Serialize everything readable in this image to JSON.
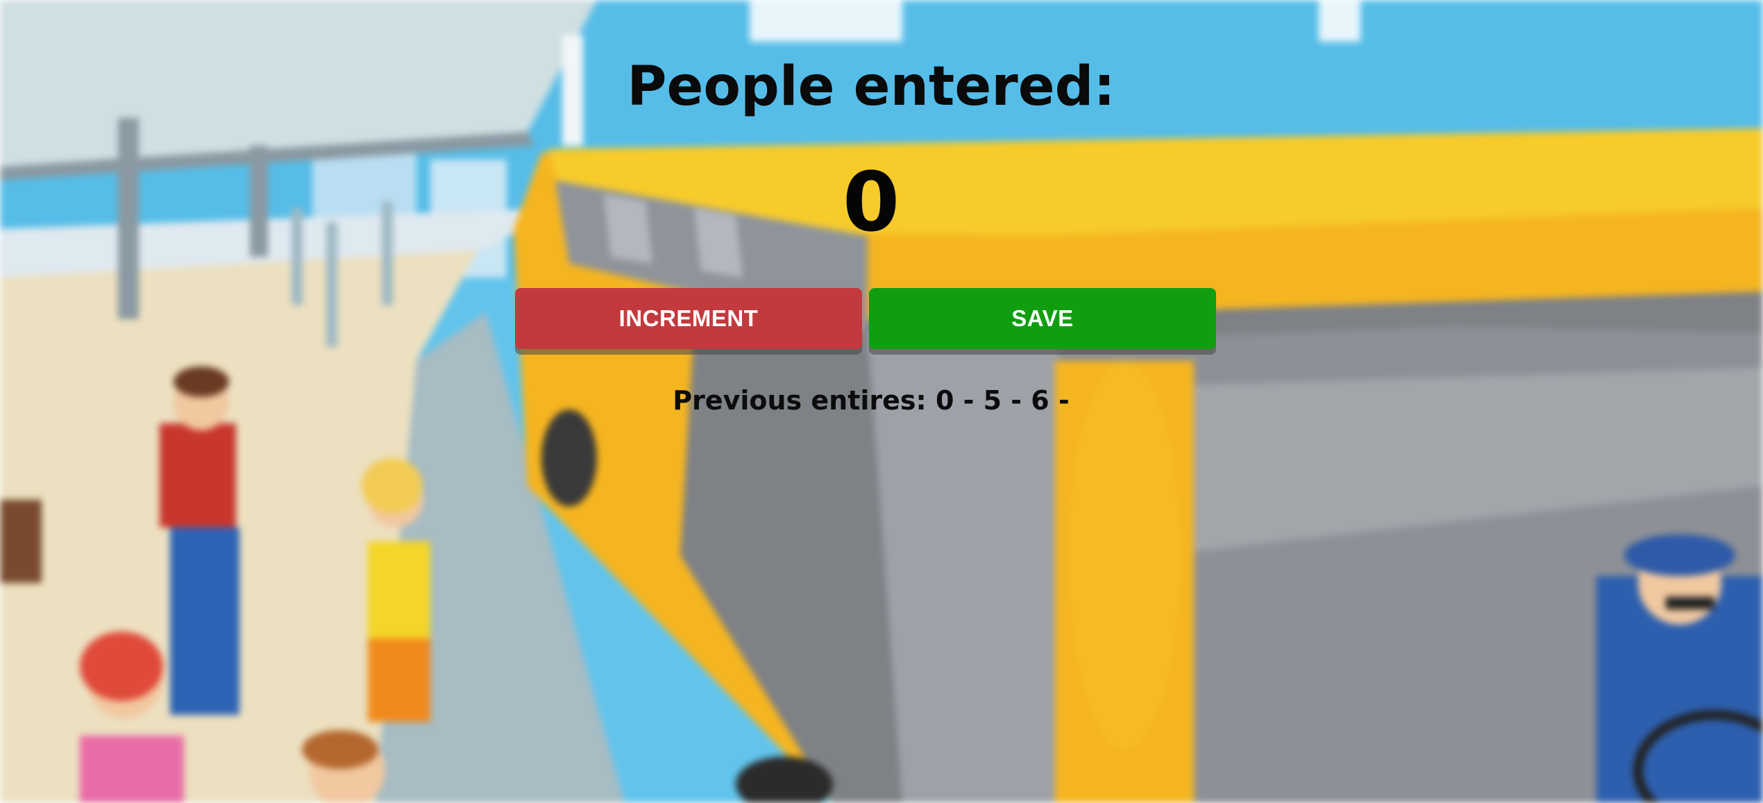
{
  "title": "People entered:",
  "count": "0",
  "buttons": {
    "increment_label": "INCREMENT",
    "save_label": "SAVE"
  },
  "previous": {
    "label": "Previous entires:",
    "entries": "0 - 5 - 6 -"
  },
  "colors": {
    "increment": "#c23a3e",
    "save": "#109e10",
    "sky": "#5ec4ec",
    "bus_yellow": "#f5b520"
  }
}
